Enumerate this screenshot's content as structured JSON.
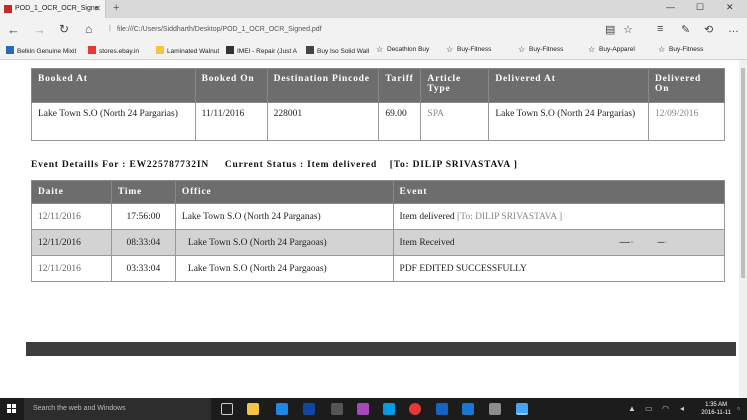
{
  "browser": {
    "tab_title": "POD_1_OCR_OCR_Signe",
    "url": "file:///C:/Users/Siddharth/Desktop/POD_1_OCR_OCR_Signed.pdf",
    "favorites": [
      {
        "label": "Belkin Genuine Mixit",
        "icon": "belkin-icon"
      },
      {
        "label": "stores.ebay.in",
        "icon": "ebay-icon"
      },
      {
        "label": "Laminated Walnut",
        "icon": "folder-icon"
      },
      {
        "label": "IMEI - Repair (Just A",
        "icon": "page-icon"
      },
      {
        "label": "Buy Iso Solid Wall",
        "icon": "page-icon"
      },
      {
        "label": "Decathlon  Buy",
        "icon": "star-icon"
      },
      {
        "label": "Buy-Fitness",
        "icon": "star-icon"
      },
      {
        "label": "Buy-Fitness",
        "icon": "star-icon"
      },
      {
        "label": "Buy-Apparel",
        "icon": "star-icon"
      },
      {
        "label": "Buy-Fitness",
        "icon": "star-icon"
      }
    ]
  },
  "booking_table": {
    "headers": [
      "Booked At",
      "Booked On",
      "Destination Pincode",
      "Tariff",
      "Article Type",
      "Delivered At",
      "Delivered On"
    ],
    "row": [
      "Lake Town S.O (North 24 Pargarias)",
      "11/11/2016",
      "228001",
      "69.00",
      "SPA",
      "Lake Town S.O (North 24 Pargarias)",
      "12/09/2016"
    ]
  },
  "event_header": {
    "label": "Event Detaills For :",
    "article_no": "EW225787732IN",
    "status_label": "Current Status :",
    "status": "Item delivered",
    "to": "[To: DILIP SRIVASTAVA ]"
  },
  "events_table": {
    "headers": [
      "Daite",
      "Time",
      "Office",
      "Event"
    ],
    "rows": [
      {
        "date": "12/11/2016",
        "time": "17:56:00",
        "office": "Lake Town S.O (North 24 Parganas)",
        "event": "Item delivered",
        "event_extra": "[To: DILIP SRIVASTAVA ]"
      },
      {
        "date": "12/11/2016",
        "time": "08:33:04",
        "office": "Lake Town S.O (North 24 Pargaoas)",
        "event": "Item Received",
        "event_extra": ""
      },
      {
        "date": "12/11/2016",
        "time": "03:33:04",
        "office": "Lake Town S.O (North 24 Pargaoas)",
        "event": "PDF EDITED SUCCESSFULLY",
        "event_extra": ""
      }
    ]
  },
  "taskbar": {
    "search_placeholder": "Search the web and Windows",
    "time": "1:35 AM",
    "date": "2016-11-11"
  }
}
